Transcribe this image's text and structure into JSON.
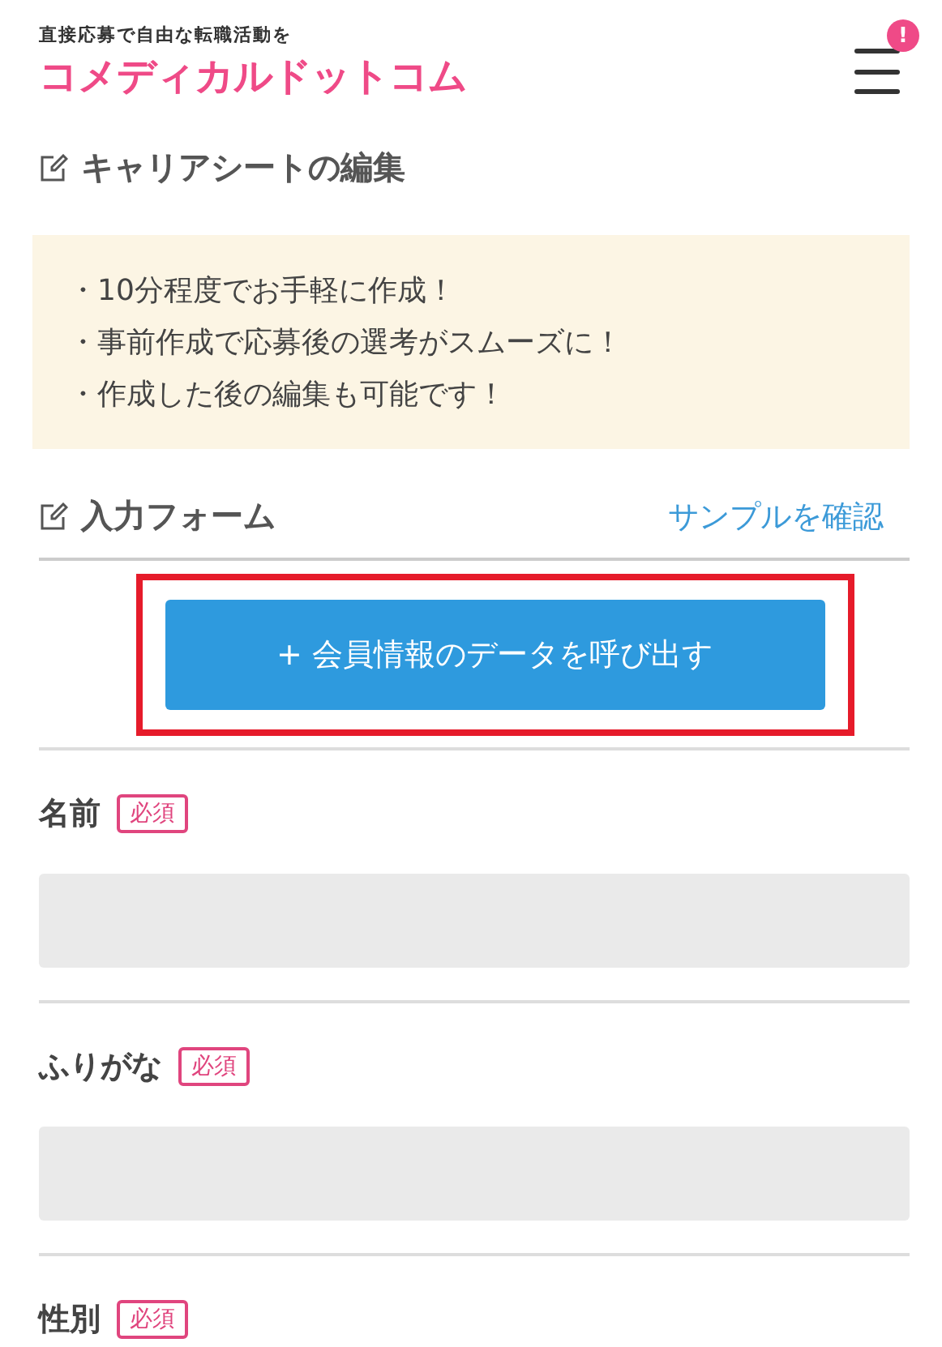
{
  "header": {
    "tagline": "直接応募で自由な転職活動を",
    "logo": "コメディカルドットコム",
    "menu_badge": "!"
  },
  "page_title": "キャリアシートの編集",
  "notice": [
    "・10分程度でお手軽に作成！",
    "・事前作成で応募後の選考がスムーズに！",
    "・作成した後の編集も可能です！"
  ],
  "form_header": {
    "title": "入力フォーム",
    "link": "サンプルを確認"
  },
  "import_button": {
    "label": "+ 会員情報のデータを呼び出す",
    "highlighted": true
  },
  "fields": [
    {
      "kind": "text",
      "label": "名前",
      "badge": "必須"
    },
    {
      "kind": "text",
      "label": "ふりがな",
      "badge": "必須"
    },
    {
      "kind": "label_only",
      "label": "性別",
      "badge": "必須"
    }
  ]
}
